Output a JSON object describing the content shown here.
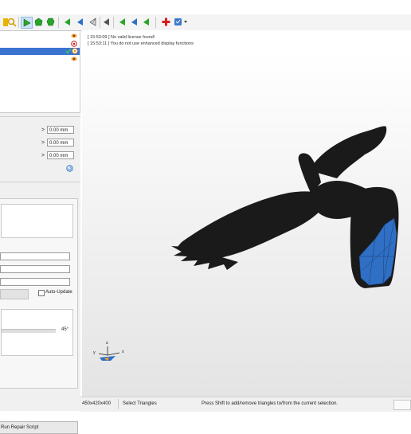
{
  "toolbar": {
    "icons": [
      "yellow-square-icon",
      "magnifier-icon",
      "select-triangle-icon",
      "select-surface-icon",
      "select-shell-icon",
      "green-arrow-icon",
      "blue-arrow-icon",
      "wireframe-triangle-icon",
      "flag-icon",
      "green-arrow-left-icon",
      "blue-arrow-left-icon",
      "green-arrow-right-icon",
      "add-red-cross-icon",
      "script-dropdown-icon"
    ]
  },
  "tree": {
    "rows": [
      {
        "label": "",
        "selected": false,
        "icon": "orange-eye-icon"
      },
      {
        "label": "",
        "selected": false,
        "icon": "red-target-icon"
      },
      {
        "label": "",
        "selected": true,
        "icon": "checkmark-icon"
      },
      {
        "label": "",
        "selected": false,
        "icon": "orange-eye-icon"
      }
    ]
  },
  "properties": {
    "fields": [
      {
        "arrow": ">",
        "value": "0.00 mm"
      },
      {
        "arrow": ">",
        "value": "0.00 mm"
      },
      {
        "arrow": ">",
        "value": "0.00 mm"
      }
    ]
  },
  "selection_panel": {
    "auto_update_label": "Auto-Update",
    "angle_value": "45°"
  },
  "run_script_label": "Run Repair Script",
  "log": {
    "lines": [
      "[ 15:53:09 ] No valid license found!",
      "[ 15:53:11 ] You do not use enhanced display functions"
    ]
  },
  "axes": {
    "x": "x",
    "y": "y",
    "z": "z"
  },
  "status": {
    "dimensions": "450x420x400",
    "mode": "Select Triangles",
    "hint": "Press Shift to add/remove triangles to/from the current selection."
  },
  "colors": {
    "selection_blue": "#2f6fc4",
    "tree_highlight": "#3b73d1",
    "model": "#1a1a1a"
  }
}
